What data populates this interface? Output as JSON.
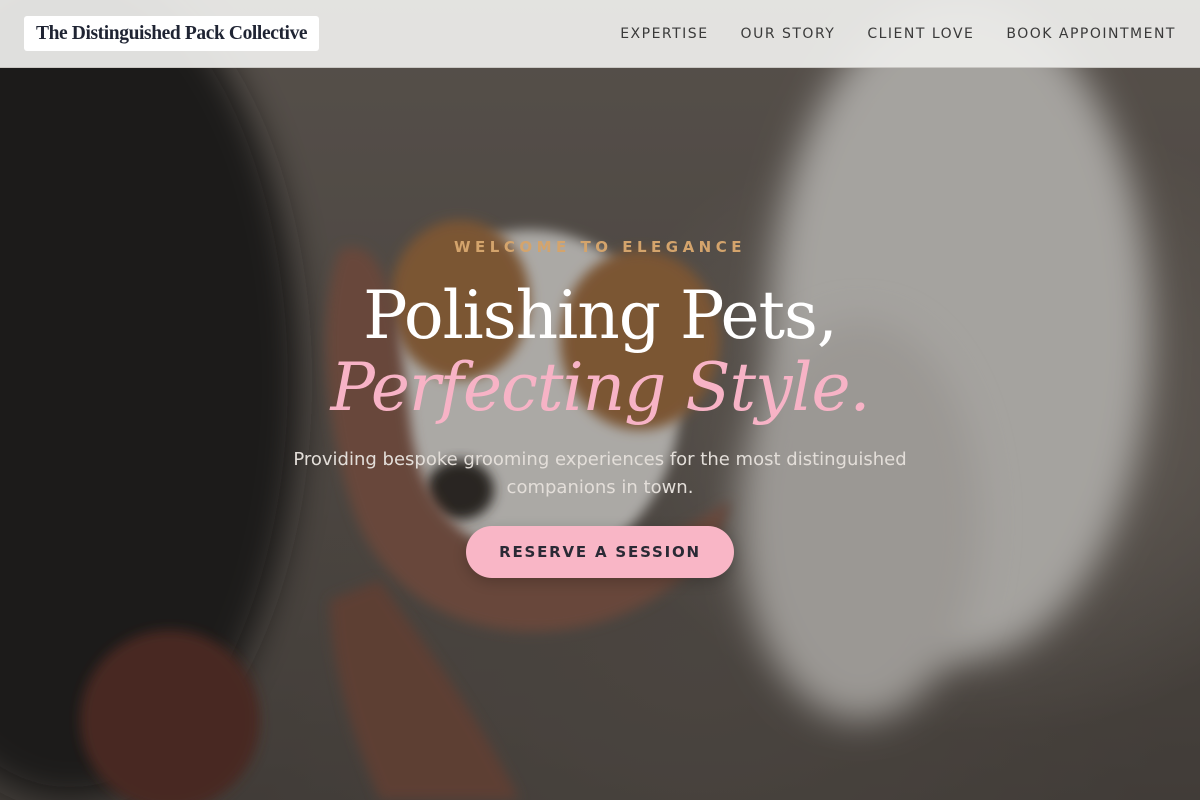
{
  "header": {
    "brand": "The Distinguished Pack Collective",
    "nav": [
      {
        "label": "EXPERTISE"
      },
      {
        "label": "OUR STORY"
      },
      {
        "label": "CLIENT LOVE"
      },
      {
        "label": "BOOK APPOINTMENT"
      }
    ]
  },
  "hero": {
    "eyebrow": "WELCOME TO ELEGANCE",
    "headline_line1": "Polishing Pets,",
    "headline_line2": "Perfecting Style.",
    "subtitle": "Providing bespoke grooming experiences for the most distinguished companions in town.",
    "cta_label": "RESERVE A SESSION",
    "background_image": "person-holding-dog-face-photo"
  },
  "colors": {
    "header_bg": "#ececea",
    "brand_text": "#1f2433",
    "nav_text": "#3a3a3a",
    "eyebrow": "#d4a46c",
    "headline": "#ffffff",
    "headline_accent": "#f7b3c6",
    "subtitle": "#e3ded9",
    "cta_bg": "#f9b6c6",
    "cta_text": "#2a2a35"
  }
}
